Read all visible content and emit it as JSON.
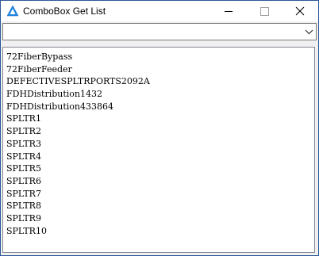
{
  "window": {
    "title": "ComboBox Get List"
  },
  "combo": {
    "value": ""
  },
  "list": {
    "items": [
      "72FiberBypass",
      "72FiberFeeder",
      "DEFECTIVESPLTRPORTS2092A",
      "FDHDistribution1432",
      "FDHDistribution433864",
      "SPLTR1",
      "SPLTR2",
      "SPLTR3",
      "SPLTR4",
      "SPLTR5",
      "SPLTR6",
      "SPLTR7",
      "SPLTR8",
      "SPLTR9",
      "SPLTR10"
    ]
  },
  "colors": {
    "accent": "#2b579a"
  }
}
